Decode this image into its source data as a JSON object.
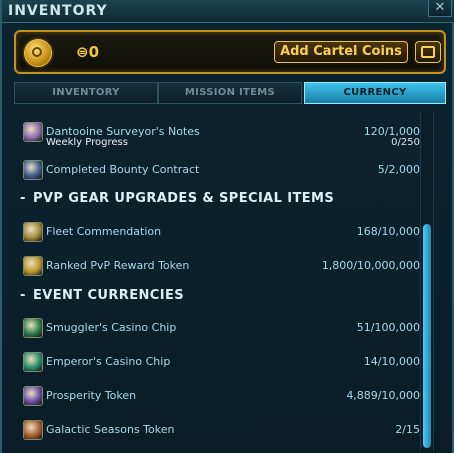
{
  "window": {
    "title": "INVENTORY",
    "close_glyph": "✕"
  },
  "cartel": {
    "icon": "cartel-coin-icon",
    "balance": "⊜0",
    "add_button": "Add Cartel Coins",
    "market_icon": "cartel-market-icon"
  },
  "tabs": [
    {
      "label": "INVENTORY",
      "active": false
    },
    {
      "label": "MISSION ITEMS",
      "active": false
    },
    {
      "label": "CURRENCY",
      "active": true
    }
  ],
  "rows": [
    {
      "name": "Dantooine Surveyor's Notes",
      "value": "120/1,000",
      "sub": "Weekly Progress",
      "subvalue": "0/250",
      "icon": "surveyor-notes-icon",
      "icon_color": "#8a6aa8"
    },
    {
      "name": "Completed Bounty Contract",
      "value": "5/2,000",
      "icon": "bounty-contract-icon",
      "icon_color": "#3a5a8a"
    },
    {
      "name": "Fleet Commendation",
      "value": "168/10,000",
      "icon": "fleet-commendation-icon",
      "icon_color": "#a08a3a"
    },
    {
      "name": "Ranked PvP Reward Token",
      "value": "1,800/10,000,000",
      "icon": "ranked-pvp-token-icon",
      "icon_color": "#b8962a"
    },
    {
      "name": "Smuggler's Casino Chip",
      "value": "51/100,000",
      "icon": "smuggler-casino-chip-icon",
      "icon_color": "#2e7a4a"
    },
    {
      "name": "Emperor's Casino Chip",
      "value": "14/10,000",
      "icon": "emperor-casino-chip-icon",
      "icon_color": "#2c8a6a"
    },
    {
      "name": "Prosperity Token",
      "value": "4,889/10,000",
      "icon": "prosperity-token-icon",
      "icon_color": "#6a4aa0"
    },
    {
      "name": "Galactic Seasons Token",
      "value": "2/15",
      "icon": "galactic-seasons-token-icon",
      "icon_color": "#a85a2a"
    }
  ],
  "sections": [
    {
      "dash": "-",
      "title": "PVP GEAR UPGRADES & SPECIAL ITEMS"
    },
    {
      "dash": "-",
      "title": "EVENT CURRENCIES"
    }
  ],
  "colors": {
    "accent": "#3cc3ec",
    "gold": "#f4c542",
    "text": "#a8d8ec"
  }
}
